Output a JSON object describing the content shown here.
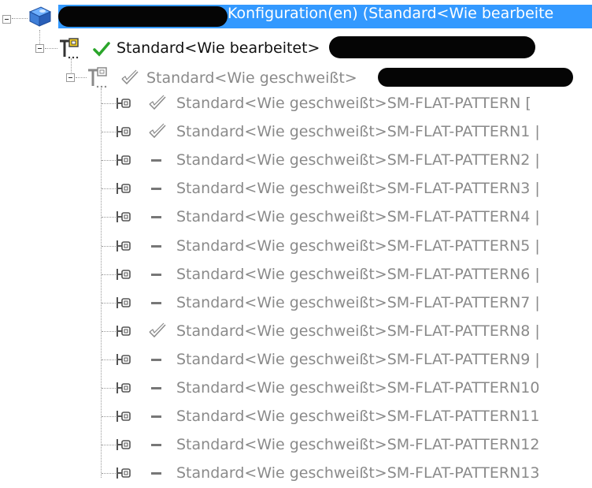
{
  "root": {
    "label": "Konfiguration(en)  (Standard<Wie bearbeite",
    "selected_color": "#3399ff",
    "icon": "part-icon"
  },
  "level1": {
    "label": "Standard<Wie bearbeitet>",
    "check_color": "#2aa52a",
    "icon": "configuration-icon"
  },
  "level2": {
    "label": "Standard<Wie geschweißt>",
    "icon": "configuration-icon"
  },
  "items": [
    {
      "label": "Standard<Wie geschweißt>SM-FLAT-PATTERN [",
      "state": "check"
    },
    {
      "label": "Standard<Wie geschweißt>SM-FLAT-PATTERN1 |",
      "state": "check"
    },
    {
      "label": "Standard<Wie geschweißt>SM-FLAT-PATTERN2 |",
      "state": "dash"
    },
    {
      "label": "Standard<Wie geschweißt>SM-FLAT-PATTERN3 |",
      "state": "dash"
    },
    {
      "label": "Standard<Wie geschweißt>SM-FLAT-PATTERN4 |",
      "state": "dash"
    },
    {
      "label": "Standard<Wie geschweißt>SM-FLAT-PATTERN5 |",
      "state": "dash"
    },
    {
      "label": "Standard<Wie geschweißt>SM-FLAT-PATTERN6 |",
      "state": "dash"
    },
    {
      "label": "Standard<Wie geschweißt>SM-FLAT-PATTERN7 |",
      "state": "dash"
    },
    {
      "label": "Standard<Wie geschweißt>SM-FLAT-PATTERN8 |",
      "state": "check"
    },
    {
      "label": "Standard<Wie geschweißt>SM-FLAT-PATTERN9 |",
      "state": "dash"
    },
    {
      "label": "Standard<Wie geschweißt>SM-FLAT-PATTERN10",
      "state": "dash"
    },
    {
      "label": "Standard<Wie geschweißt>SM-FLAT-PATTERN11",
      "state": "dash"
    },
    {
      "label": "Standard<Wie geschweißt>SM-FLAT-PATTERN12",
      "state": "dash"
    },
    {
      "label": "Standard<Wie geschweißt>SM-FLAT-PATTERN13",
      "state": "dash"
    }
  ]
}
